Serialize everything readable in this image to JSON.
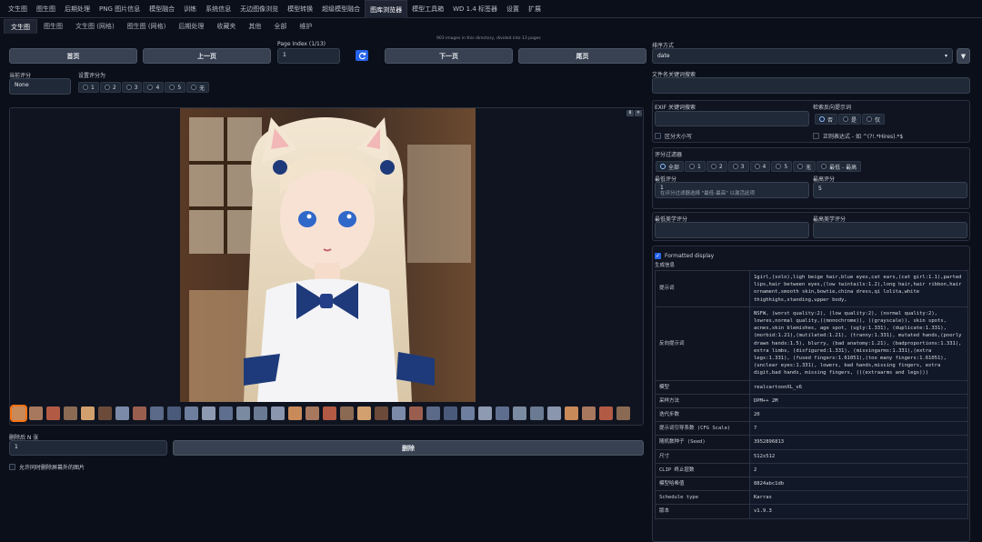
{
  "top_tabs": [
    "文生图",
    "图生图",
    "后期处理",
    "PNG 图片信息",
    "模型融合",
    "训练",
    "系统信息",
    "无边图像浏览",
    "模型转换",
    "超级模型融合",
    "图库浏览器",
    "模型工具箱",
    "WD 1.4 标签器",
    "设置",
    "扩展"
  ],
  "sub_tabs": [
    "文生图",
    "图生图",
    "文生图 (网格)",
    "图生图 (网格)",
    "后期处理",
    "收藏夹",
    "其他",
    "全部",
    "维护"
  ],
  "nav": {
    "info_text": "903 images in this directory, divided into 13 pages",
    "first": "首页",
    "prev": "上一页",
    "page_index_label": "Page Index (1/13)",
    "page_index_value": "1",
    "refresh_icon": "refresh-icon",
    "next": "下一页",
    "last": "尾页"
  },
  "rating": {
    "current_label": "当前评分",
    "current_value": "None",
    "set_label": "设置评分为",
    "options": [
      "1",
      "2",
      "3",
      "4",
      "5",
      "无"
    ]
  },
  "delete": {
    "label": "删除后 N 张",
    "value": "1",
    "button": "删除",
    "allow_label": "允许同时删除屏幕外的图片"
  },
  "right": {
    "sort_label": "排序方式",
    "sort_value": "date",
    "filename_label": "文件名关键词搜索",
    "exif_label": "EXIF 关键词搜索",
    "case_label": "区分大小写",
    "neg_label": "检索反向提示词",
    "neg_options": [
      "否",
      "是",
      "仅"
    ],
    "regex_label": "正则表达式 - 如 ^(?!.*Hires).*$",
    "score_filter_label": "评分过滤器",
    "score_options": [
      "全部",
      "1",
      "2",
      "3",
      "4",
      "5",
      "无",
      "最低 - 最高"
    ],
    "min_label": "最低评分",
    "min_value": "1",
    "min_hint": "在评分过滤器选择 \"最低-最高\" 以激活此项",
    "max_label": "最高评分",
    "max_value": "5",
    "min_aes_label": "最低美学评分",
    "max_aes_label": "最高美学评分",
    "formatted_label": "Formatted display",
    "gen_info_label": "生成信息"
  },
  "meta_rows": [
    {
      "k": "提示词",
      "v": "1girl,(solo),ligh beige hair,blue eyes,cat ears,(cat girl:1.1),parted lips,hair between eyes,(low twintails:1.2),long hair,hair ribbon,hair ornament,smooth skin,bowtie,china dress,qi lolita,white thighhighs,standing,upper body,"
    },
    {
      "k": "反向提示词",
      "v": "NSFW, (worst quality:2), (low quality:2), (normal quality:2), lowres,normal quality,((monochrome)), ((grayscale)), skin spots, acnes,skin blemishes, age spot, (ugly:1.331), (duplicate:1.331), (morbid:1.21),(mutilated:1.21), (tranny:1.331), mutated hands,(poorly drawn hands:1.5), blurry, (bad anatomy:1.21), (badproportions:1.331), extra limbs, (disfigured:1.331), (missingarms:1.331),(extra legs:1.331), (fused fingers:1.61051),(too many fingers:1.61051), (unclear eyes:1.331), lowers, bad hands,missing fingers, extra digit,bad hands, missing fingers, (((extraarms and legs)))"
    },
    {
      "k": "模型",
      "v": "realcartoonXL_v6"
    },
    {
      "k": "采样方法",
      "v": "DPM++ 2M"
    },
    {
      "k": "迭代步数",
      "v": "20"
    },
    {
      "k": "提示词引导系数 (CFG Scale)",
      "v": "7"
    },
    {
      "k": "随机数种子 (Seed)",
      "v": "3952896813"
    },
    {
      "k": "尺寸",
      "v": "512x512"
    },
    {
      "k": "CLIP 终止层数",
      "v": "2"
    },
    {
      "k": "模型哈希值",
      "v": "8824abc1db"
    },
    {
      "k": "Schedule type",
      "v": "Karras"
    },
    {
      "k": "版本",
      "v": "v1.9.3"
    }
  ],
  "thumbnail_count": 36,
  "colors": {
    "accent": "#2563eb",
    "background": "#0b0f19",
    "panel": "#1f2937"
  }
}
